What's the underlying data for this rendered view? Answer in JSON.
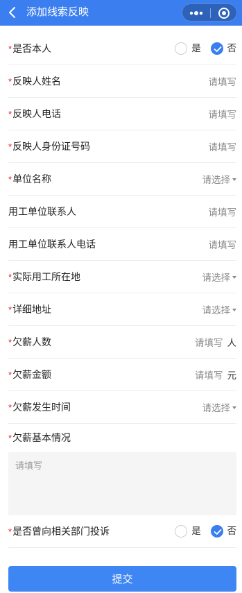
{
  "navbar": {
    "title": "添加线索反映",
    "back_icon": "chevron-left-icon",
    "more_icon": "more-dots-icon",
    "close_icon": "target-circle-icon",
    "color": "#3a7ef0"
  },
  "form": {
    "is_self": {
      "label": "是否本人",
      "required": "*",
      "yes": "是",
      "no": "否",
      "selected": "否"
    },
    "reporter_name": {
      "label": "反映人姓名",
      "required": "*",
      "placeholder": "请填写"
    },
    "reporter_phone": {
      "label": "反映人电话",
      "required": "*",
      "placeholder": "请填写"
    },
    "reporter_id": {
      "label": "反映人身份证号码",
      "required": "*",
      "placeholder": "请填写"
    },
    "unit_name": {
      "label": "单位名称",
      "required": "*",
      "placeholder": "请选择"
    },
    "employer_contact": {
      "label": "用工单位联系人",
      "placeholder": "请填写"
    },
    "employer_contact_phone": {
      "label": "用工单位联系人电话",
      "placeholder": "请填写"
    },
    "work_location": {
      "label": "实际用工所在地",
      "required": "*",
      "placeholder": "请选择"
    },
    "address": {
      "label": "详细地址",
      "required": "*",
      "placeholder": "请选择"
    },
    "owed_count": {
      "label": "欠薪人数",
      "required": "*",
      "placeholder": "请填写",
      "unit": "人"
    },
    "owed_amount": {
      "label": "欠薪金额",
      "required": "*",
      "placeholder": "请填写",
      "unit": "元"
    },
    "owed_time": {
      "label": "欠薪发生时间",
      "required": "*",
      "placeholder": "请选择"
    },
    "owed_details": {
      "label": "欠薪基本情况",
      "required": "*",
      "placeholder": "请填写"
    },
    "complained": {
      "label": "是否曾向相关部门投诉",
      "required": "*",
      "yes": "是",
      "no": "否",
      "selected": "否"
    }
  },
  "submit_label": "提交",
  "accent_color": "#3a7ef0",
  "required_color": "#e6231f"
}
